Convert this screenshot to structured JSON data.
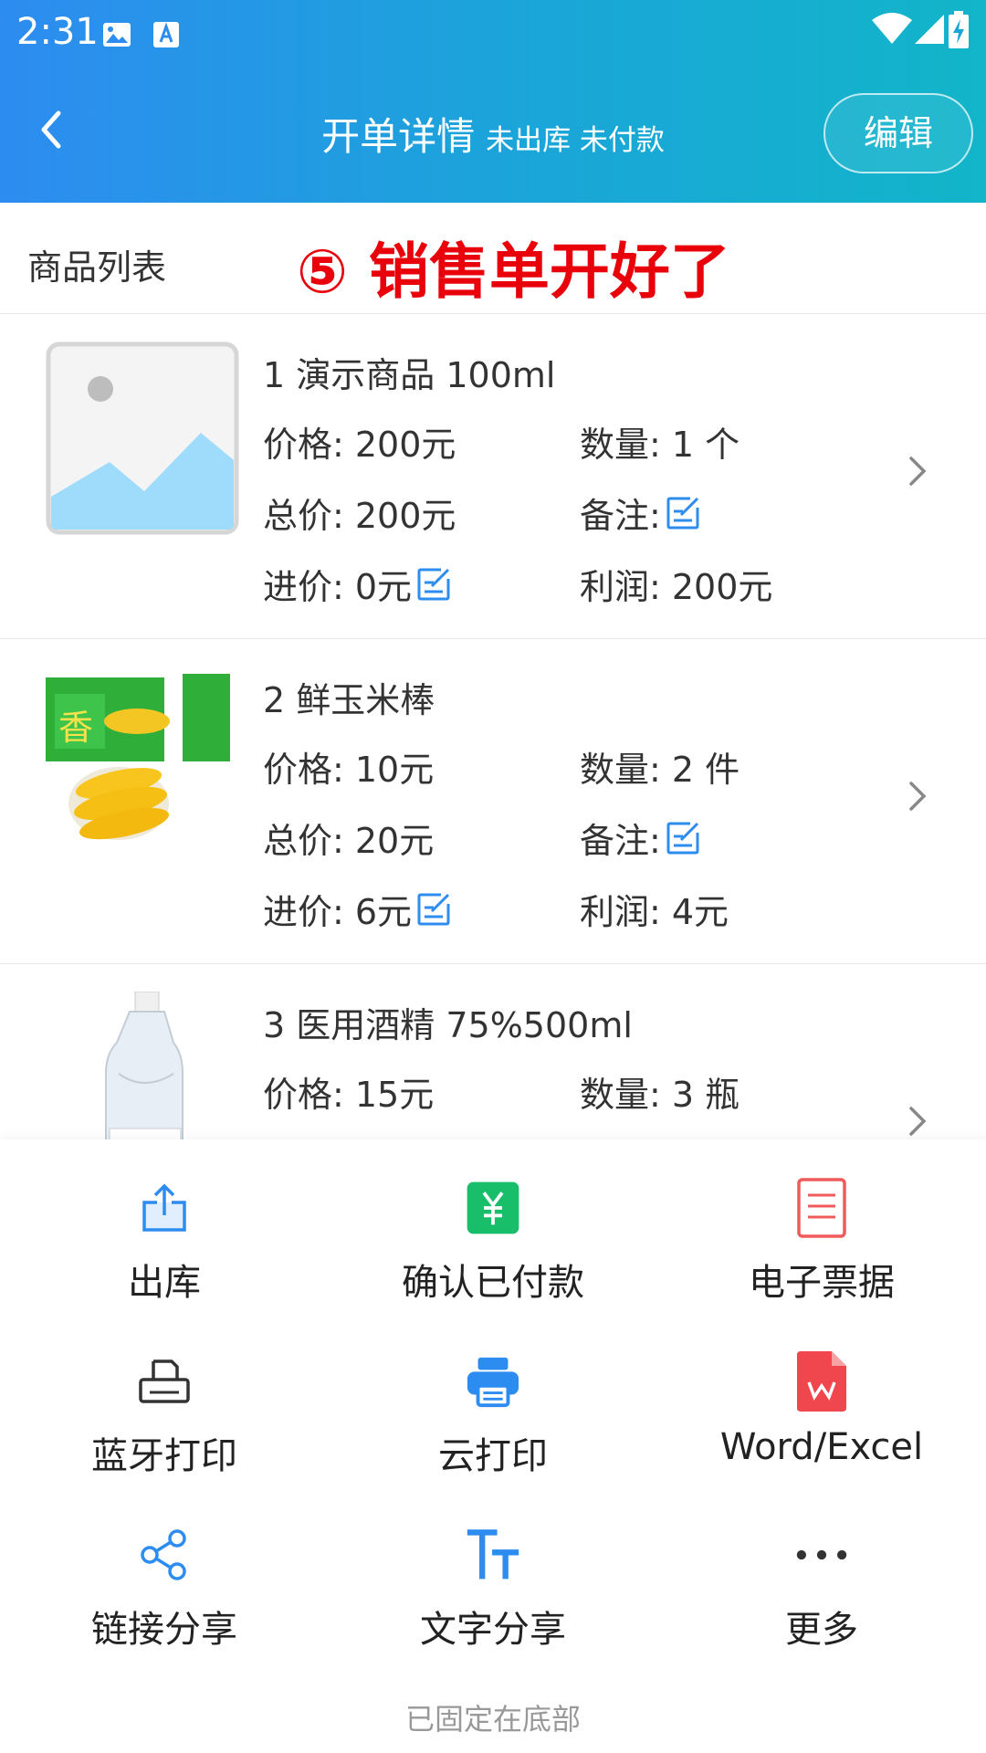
{
  "status_bar": {
    "time": "2:31"
  },
  "header": {
    "title": "开单详情",
    "subtitle": "未出库 未付款",
    "edit_label": "编辑"
  },
  "section": {
    "title": "商品列表",
    "annotation": "⑤ 销售单开好了"
  },
  "products": [
    {
      "name": "1 演示商品 100ml",
      "price": "价格: 200元",
      "quantity": "数量: 1 个",
      "total": "总价: 200元",
      "note": "备注:",
      "cost": "进价: 0元",
      "profit": "利润: 200元"
    },
    {
      "name": "2 鲜玉米棒",
      "price": "价格: 10元",
      "quantity": "数量: 2 件",
      "total": "总价: 20元",
      "note": "备注:",
      "cost": "进价: 6元",
      "profit": "利润: 4元"
    },
    {
      "name": "3 医用酒精 75%500ml",
      "price": "价格: 15元",
      "quantity": "数量: 3 瓶"
    }
  ],
  "actions": [
    {
      "label": "出库",
      "icon": "export-icon"
    },
    {
      "label": "确认已付款",
      "icon": "yuan-payment-icon"
    },
    {
      "label": "电子票据",
      "icon": "document-icon"
    },
    {
      "label": "蓝牙打印",
      "icon": "bluetooth-printer-icon"
    },
    {
      "label": "云打印",
      "icon": "cloud-printer-icon"
    },
    {
      "label": "Word/Excel",
      "icon": "word-excel-icon"
    },
    {
      "label": "链接分享",
      "icon": "share-icon"
    },
    {
      "label": "文字分享",
      "icon": "text-icon"
    },
    {
      "label": "更多",
      "icon": "more-icon"
    }
  ],
  "pinned_text": "已固定在底部",
  "colors": {
    "header_start": "#2d8cf0",
    "header_end": "#12b5c9",
    "annotation": "#e8000b",
    "accent_blue": "#2d8cf0",
    "payment_green": "#19be6b",
    "doc_red": "#f05a5a"
  }
}
